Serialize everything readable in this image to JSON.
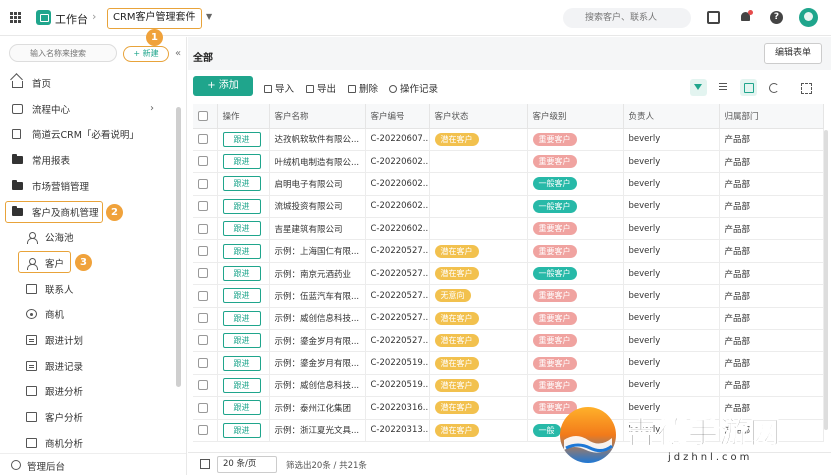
{
  "topbar": {
    "app_title": "工作台",
    "suite_name": "CRM客户管理套件",
    "search_placeholder": "搜索客户、联系人"
  },
  "sidebar": {
    "search_placeholder": "输入名称来搜索",
    "new_button": "+ 新建",
    "items": [
      {
        "label": "首页",
        "icon": "home-icon"
      },
      {
        "label": "流程中心",
        "icon": "flow-icon",
        "has_children": true
      },
      {
        "label": "简道云CRM「必看说明」",
        "icon": "document-icon"
      },
      {
        "label": "常用报表",
        "icon": "folder-icon"
      },
      {
        "label": "市场营销管理",
        "icon": "folder-icon"
      },
      {
        "label": "客户及商机管理",
        "icon": "folder-icon",
        "highlighted": true
      },
      {
        "label": "公海池",
        "icon": "person-icon"
      },
      {
        "label": "客户",
        "icon": "person-icon",
        "highlighted": true,
        "active": true
      },
      {
        "label": "联系人",
        "icon": "card-icon"
      },
      {
        "label": "商机",
        "icon": "target-icon"
      },
      {
        "label": "跟进计划",
        "icon": "list-icon"
      },
      {
        "label": "跟进记录",
        "icon": "list-icon"
      },
      {
        "label": "跟进分析",
        "icon": "chart-icon"
      },
      {
        "label": "客户分析",
        "icon": "chart-icon"
      },
      {
        "label": "商机分析",
        "icon": "chart-icon"
      }
    ],
    "footer_label": "管理后台",
    "callouts": [
      "1",
      "2",
      "3"
    ]
  },
  "main": {
    "page_title": "全部",
    "edit_form_button": "编辑表单",
    "toolbar": {
      "add": "+ 添加",
      "import": "导入",
      "export": "导出",
      "delete": "删除",
      "log": "操作记录"
    },
    "columns": [
      "操作",
      "客户名称",
      "客户编号",
      "客户状态",
      "客户级别",
      "负责人",
      "归属部门"
    ],
    "action_label": "跟进",
    "rows": [
      {
        "name": "达孜帆软软件有限公...",
        "code": "C-20220607...",
        "status": "潜在客户",
        "level": "重要客户",
        "owner": "beverly",
        "dept": "产品部"
      },
      {
        "name": "叶绒机电制造有限公...",
        "code": "C-20220602...",
        "status": "",
        "level": "重要客户",
        "owner": "beverly",
        "dept": "产品部"
      },
      {
        "name": "启明电子有限公司",
        "code": "C-20220602...",
        "status": "",
        "level": "一般客户",
        "owner": "beverly",
        "dept": "产品部"
      },
      {
        "name": "流城投资有限公司",
        "code": "C-20220602...",
        "status": "",
        "level": "一般客户",
        "owner": "beverly",
        "dept": "产品部"
      },
      {
        "name": "吉星建筑有限公司",
        "code": "C-20220602...",
        "status": "",
        "level": "重要客户",
        "owner": "beverly",
        "dept": "产品部"
      },
      {
        "name": "示例：上海国仁有限...",
        "code": "C-20220527...",
        "status": "潜在客户",
        "level": "重要客户",
        "owner": "beverly",
        "dept": "产品部"
      },
      {
        "name": "示例：南京元酒药业",
        "code": "C-20220527...",
        "status": "潜在客户",
        "level": "一般客户",
        "owner": "beverly",
        "dept": "产品部"
      },
      {
        "name": "示例：伍蓝汽车有限...",
        "code": "C-20220527...",
        "status": "无意向",
        "level": "重要客户",
        "owner": "beverly",
        "dept": "产品部"
      },
      {
        "name": "示例：威创信息科技...",
        "code": "C-20220527...",
        "status": "潜在客户",
        "level": "重要客户",
        "owner": "beverly",
        "dept": "产品部"
      },
      {
        "name": "示例：鎏金岁月有限...",
        "code": "C-20220527...",
        "status": "潜在客户",
        "level": "重要客户",
        "owner": "beverly",
        "dept": "产品部"
      },
      {
        "name": "示例：鎏金岁月有限...",
        "code": "C-20220519...",
        "status": "潜在客户",
        "level": "重要客户",
        "owner": "beverly",
        "dept": "产品部"
      },
      {
        "name": "示例：威创信息科技...",
        "code": "C-20220519...",
        "status": "潜在客户",
        "level": "重要客户",
        "owner": "beverly",
        "dept": "产品部"
      },
      {
        "name": "示例：泰州江化集团",
        "code": "C-20220316...",
        "status": "潜在客户",
        "level": "重要客户",
        "owner": "beverly",
        "dept": "产品部"
      },
      {
        "name": "示例：浙江夏光文具...",
        "code": "C-20220313...",
        "status": "潜在客户",
        "level": "一般",
        "owner": "beverly",
        "dept": "产品部"
      }
    ],
    "footer": {
      "page_size": "20 条/页",
      "info": "筛选出20条 / 共21条"
    }
  },
  "watermark": {
    "title": "吉德手游网",
    "subtitle": "jdzhnl.com"
  },
  "colors": {
    "accent": "#1fa58c",
    "callout": "#f0a23b",
    "status_potential": "#f2c14e",
    "status_none": "#f2c14e",
    "level_important": "#f0a3a0",
    "level_normal": "#27b9a8"
  }
}
